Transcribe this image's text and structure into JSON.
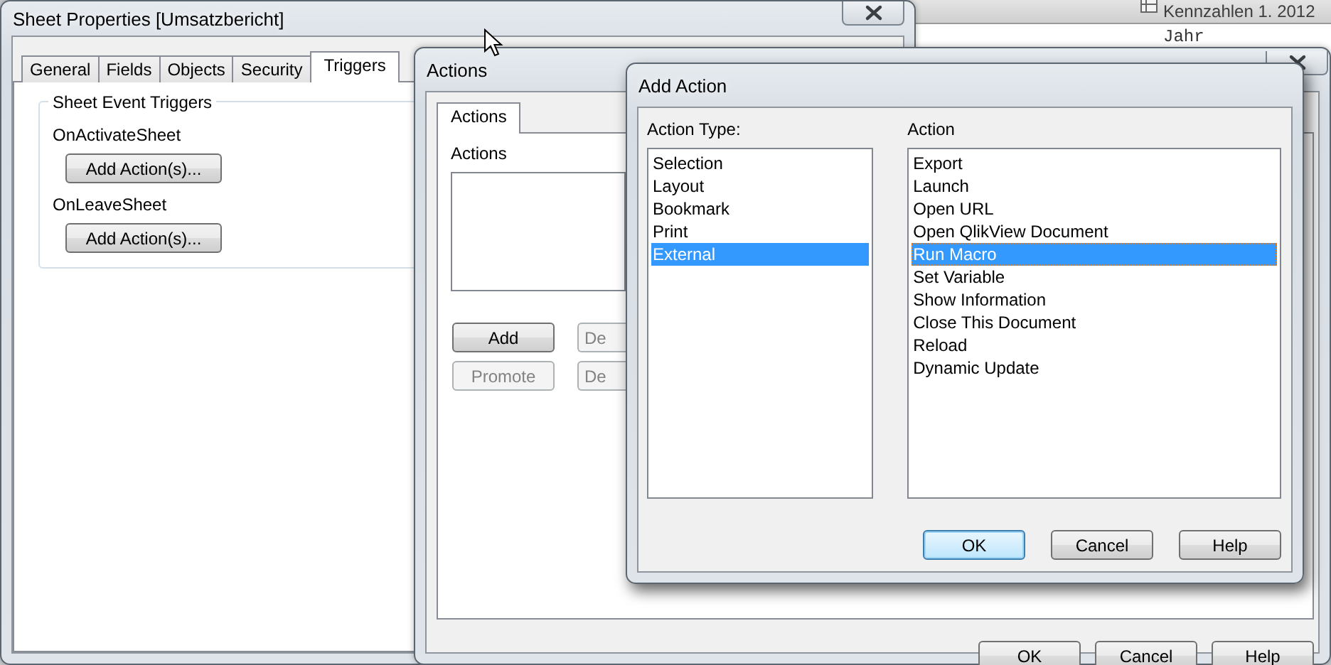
{
  "background_app": {
    "header": "Kennzahlen 1. 2012",
    "column_label": "Jahr"
  },
  "sheet_properties": {
    "title": "Sheet Properties [Umsatzbericht]",
    "tabs": [
      {
        "label": "General",
        "selected": false
      },
      {
        "label": "Fields",
        "selected": false
      },
      {
        "label": "Objects",
        "selected": false
      },
      {
        "label": "Security",
        "selected": false
      },
      {
        "label": "Triggers",
        "selected": true
      }
    ],
    "group": {
      "title": "Sheet Event Triggers",
      "triggers": [
        {
          "label": "OnActivateSheet",
          "button": "Add Action(s)..."
        },
        {
          "label": "OnLeaveSheet",
          "button": "Add Action(s)..."
        }
      ]
    }
  },
  "actions_dialog": {
    "title": "Actions",
    "tabs": [
      {
        "label": "Actions",
        "selected": true
      }
    ],
    "list_label": "Actions",
    "buttons": [
      {
        "label": "Add",
        "disabled": false
      },
      {
        "label": "De",
        "disabled": true
      },
      {
        "label": "Promote",
        "disabled": true
      },
      {
        "label": "De",
        "disabled": true
      }
    ],
    "footer_buttons": [
      {
        "label": "OK",
        "default": false
      },
      {
        "label": "Cancel",
        "default": false
      },
      {
        "label": "Help",
        "default": false
      }
    ]
  },
  "add_action": {
    "title": "Add Action",
    "action_type": {
      "label": "Action Type:",
      "items": [
        {
          "label": "Selection",
          "selected": false
        },
        {
          "label": "Layout",
          "selected": false
        },
        {
          "label": "Bookmark",
          "selected": false
        },
        {
          "label": "Print",
          "selected": false
        },
        {
          "label": "External",
          "selected": true
        }
      ]
    },
    "action": {
      "label": "Action",
      "items": [
        {
          "label": "Export",
          "selected": false
        },
        {
          "label": "Launch",
          "selected": false
        },
        {
          "label": "Open URL",
          "selected": false
        },
        {
          "label": "Open QlikView Document",
          "selected": false
        },
        {
          "label": "Run Macro",
          "selected": true
        },
        {
          "label": "Set Variable",
          "selected": false
        },
        {
          "label": "Show Information",
          "selected": false
        },
        {
          "label": "Close This Document",
          "selected": false
        },
        {
          "label": "Reload",
          "selected": false
        },
        {
          "label": "Dynamic Update",
          "selected": false
        }
      ]
    },
    "buttons": [
      {
        "label": "OK",
        "default": true
      },
      {
        "label": "Cancel",
        "default": false
      },
      {
        "label": "Help",
        "default": false
      }
    ]
  }
}
